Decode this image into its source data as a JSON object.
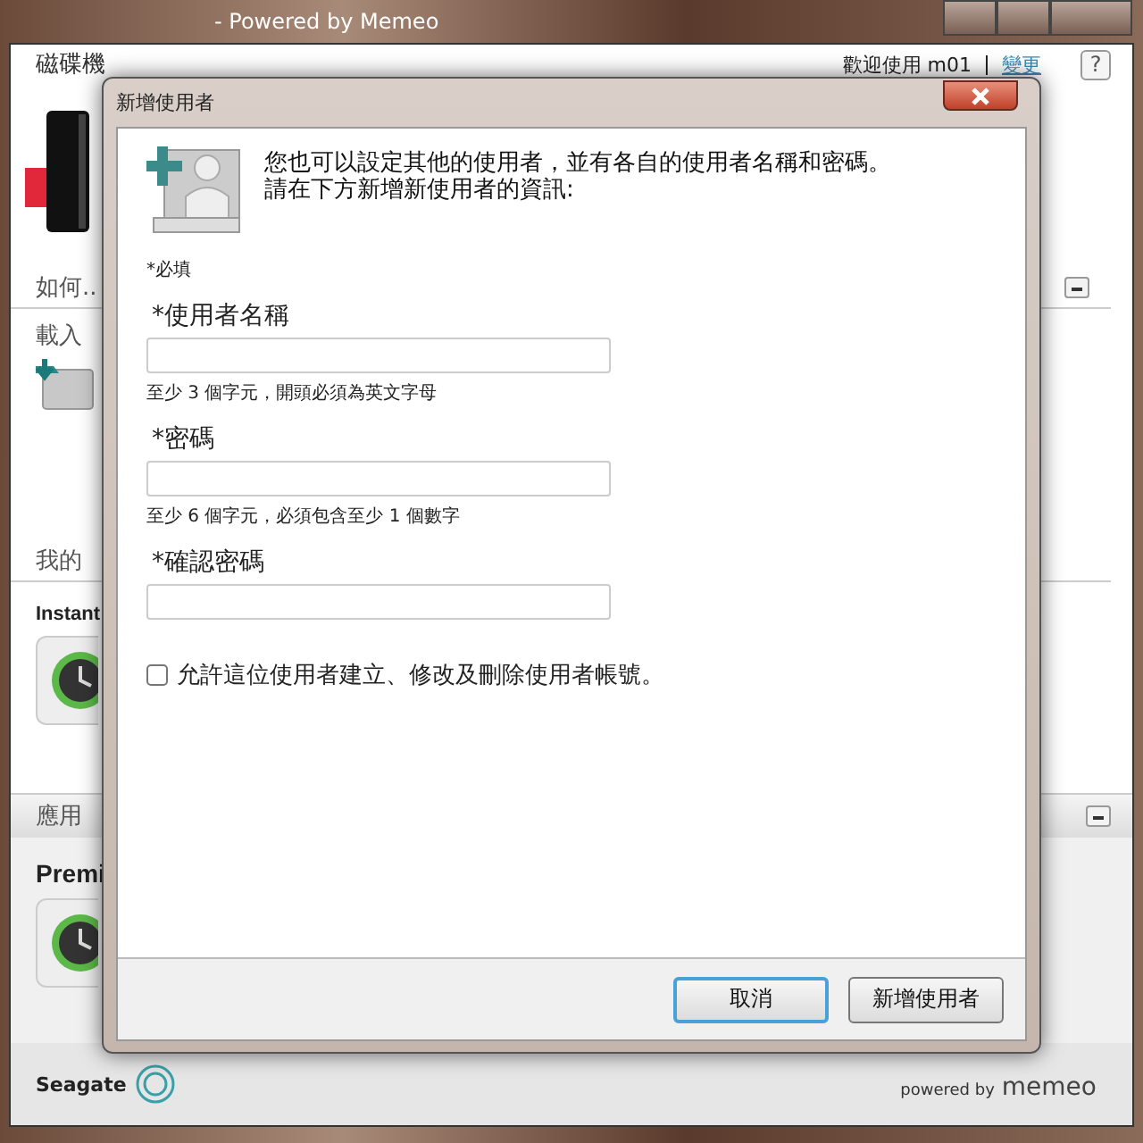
{
  "window": {
    "title": "- Powered by Memeo"
  },
  "header": {
    "title": "磁碟機",
    "welcome": "歡迎使用 m01",
    "change_link": "變更",
    "help": "?"
  },
  "how_to": {
    "title": "如何..",
    "item": "載入",
    "expanded": true
  },
  "my_section": {
    "title": "我的",
    "app": "Instant"
  },
  "apps_section": {
    "title": "應用",
    "app": "Premi",
    "expanded": true
  },
  "footer": {
    "brand": "Seagate",
    "powered_by": "powered by",
    "memeo": "memeo"
  },
  "dialog": {
    "title": "新增使用者",
    "intro": [
      "您也可以設定其他的使用者，並有各自的使用者名稱和密碼。",
      "請在下方新增新使用者的資訊:"
    ],
    "required_note": "*必填",
    "fields": [
      {
        "label": "*使用者名稱",
        "hint": "至少 3 個字元，開頭必須為英文字母"
      },
      {
        "label": "*密碼",
        "hint": "至少 6 個字元，必須包含至少 1 個數字"
      },
      {
        "label": "*確認密碼"
      }
    ],
    "permission": {
      "label": "允許這位使用者建立、修改及刪除使用者帳號。",
      "checked": false
    },
    "buttons": [
      {
        "label": "取消",
        "focused": true
      },
      {
        "label": "新增使用者",
        "focused": false
      }
    ]
  }
}
